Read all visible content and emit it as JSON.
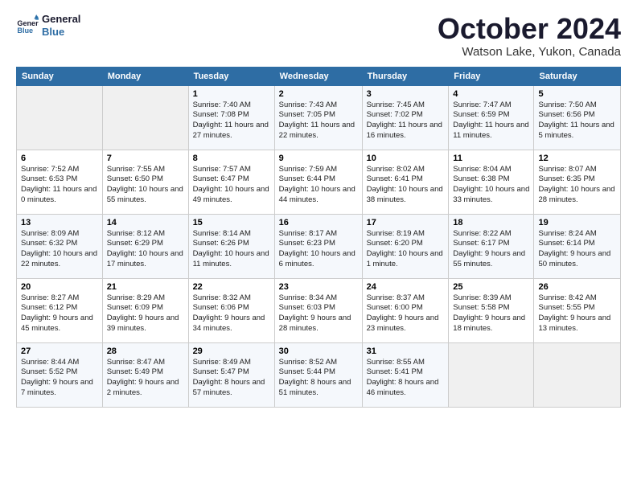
{
  "logo": {
    "line1": "General",
    "line2": "Blue"
  },
  "title": "October 2024",
  "location": "Watson Lake, Yukon, Canada",
  "days_header": [
    "Sunday",
    "Monday",
    "Tuesday",
    "Wednesday",
    "Thursday",
    "Friday",
    "Saturday"
  ],
  "weeks": [
    [
      {
        "day": "",
        "empty": true
      },
      {
        "day": "",
        "empty": true
      },
      {
        "day": "1",
        "sunrise": "7:40 AM",
        "sunset": "7:08 PM",
        "daylight": "11 hours and 27 minutes."
      },
      {
        "day": "2",
        "sunrise": "7:43 AM",
        "sunset": "7:05 PM",
        "daylight": "11 hours and 22 minutes."
      },
      {
        "day": "3",
        "sunrise": "7:45 AM",
        "sunset": "7:02 PM",
        "daylight": "11 hours and 16 minutes."
      },
      {
        "day": "4",
        "sunrise": "7:47 AM",
        "sunset": "6:59 PM",
        "daylight": "11 hours and 11 minutes."
      },
      {
        "day": "5",
        "sunrise": "7:50 AM",
        "sunset": "6:56 PM",
        "daylight": "11 hours and 5 minutes."
      }
    ],
    [
      {
        "day": "6",
        "sunrise": "7:52 AM",
        "sunset": "6:53 PM",
        "daylight": "11 hours and 0 minutes."
      },
      {
        "day": "7",
        "sunrise": "7:55 AM",
        "sunset": "6:50 PM",
        "daylight": "10 hours and 55 minutes."
      },
      {
        "day": "8",
        "sunrise": "7:57 AM",
        "sunset": "6:47 PM",
        "daylight": "10 hours and 49 minutes."
      },
      {
        "day": "9",
        "sunrise": "7:59 AM",
        "sunset": "6:44 PM",
        "daylight": "10 hours and 44 minutes."
      },
      {
        "day": "10",
        "sunrise": "8:02 AM",
        "sunset": "6:41 PM",
        "daylight": "10 hours and 38 minutes."
      },
      {
        "day": "11",
        "sunrise": "8:04 AM",
        "sunset": "6:38 PM",
        "daylight": "10 hours and 33 minutes."
      },
      {
        "day": "12",
        "sunrise": "8:07 AM",
        "sunset": "6:35 PM",
        "daylight": "10 hours and 28 minutes."
      }
    ],
    [
      {
        "day": "13",
        "sunrise": "8:09 AM",
        "sunset": "6:32 PM",
        "daylight": "10 hours and 22 minutes."
      },
      {
        "day": "14",
        "sunrise": "8:12 AM",
        "sunset": "6:29 PM",
        "daylight": "10 hours and 17 minutes."
      },
      {
        "day": "15",
        "sunrise": "8:14 AM",
        "sunset": "6:26 PM",
        "daylight": "10 hours and 11 minutes."
      },
      {
        "day": "16",
        "sunrise": "8:17 AM",
        "sunset": "6:23 PM",
        "daylight": "10 hours and 6 minutes."
      },
      {
        "day": "17",
        "sunrise": "8:19 AM",
        "sunset": "6:20 PM",
        "daylight": "10 hours and 1 minute."
      },
      {
        "day": "18",
        "sunrise": "8:22 AM",
        "sunset": "6:17 PM",
        "daylight": "9 hours and 55 minutes."
      },
      {
        "day": "19",
        "sunrise": "8:24 AM",
        "sunset": "6:14 PM",
        "daylight": "9 hours and 50 minutes."
      }
    ],
    [
      {
        "day": "20",
        "sunrise": "8:27 AM",
        "sunset": "6:12 PM",
        "daylight": "9 hours and 45 minutes."
      },
      {
        "day": "21",
        "sunrise": "8:29 AM",
        "sunset": "6:09 PM",
        "daylight": "9 hours and 39 minutes."
      },
      {
        "day": "22",
        "sunrise": "8:32 AM",
        "sunset": "6:06 PM",
        "daylight": "9 hours and 34 minutes."
      },
      {
        "day": "23",
        "sunrise": "8:34 AM",
        "sunset": "6:03 PM",
        "daylight": "9 hours and 28 minutes."
      },
      {
        "day": "24",
        "sunrise": "8:37 AM",
        "sunset": "6:00 PM",
        "daylight": "9 hours and 23 minutes."
      },
      {
        "day": "25",
        "sunrise": "8:39 AM",
        "sunset": "5:58 PM",
        "daylight": "9 hours and 18 minutes."
      },
      {
        "day": "26",
        "sunrise": "8:42 AM",
        "sunset": "5:55 PM",
        "daylight": "9 hours and 13 minutes."
      }
    ],
    [
      {
        "day": "27",
        "sunrise": "8:44 AM",
        "sunset": "5:52 PM",
        "daylight": "9 hours and 7 minutes."
      },
      {
        "day": "28",
        "sunrise": "8:47 AM",
        "sunset": "5:49 PM",
        "daylight": "9 hours and 2 minutes."
      },
      {
        "day": "29",
        "sunrise": "8:49 AM",
        "sunset": "5:47 PM",
        "daylight": "8 hours and 57 minutes."
      },
      {
        "day": "30",
        "sunrise": "8:52 AM",
        "sunset": "5:44 PM",
        "daylight": "8 hours and 51 minutes."
      },
      {
        "day": "31",
        "sunrise": "8:55 AM",
        "sunset": "5:41 PM",
        "daylight": "8 hours and 46 minutes."
      },
      {
        "day": "",
        "empty": true
      },
      {
        "day": "",
        "empty": true
      }
    ]
  ]
}
